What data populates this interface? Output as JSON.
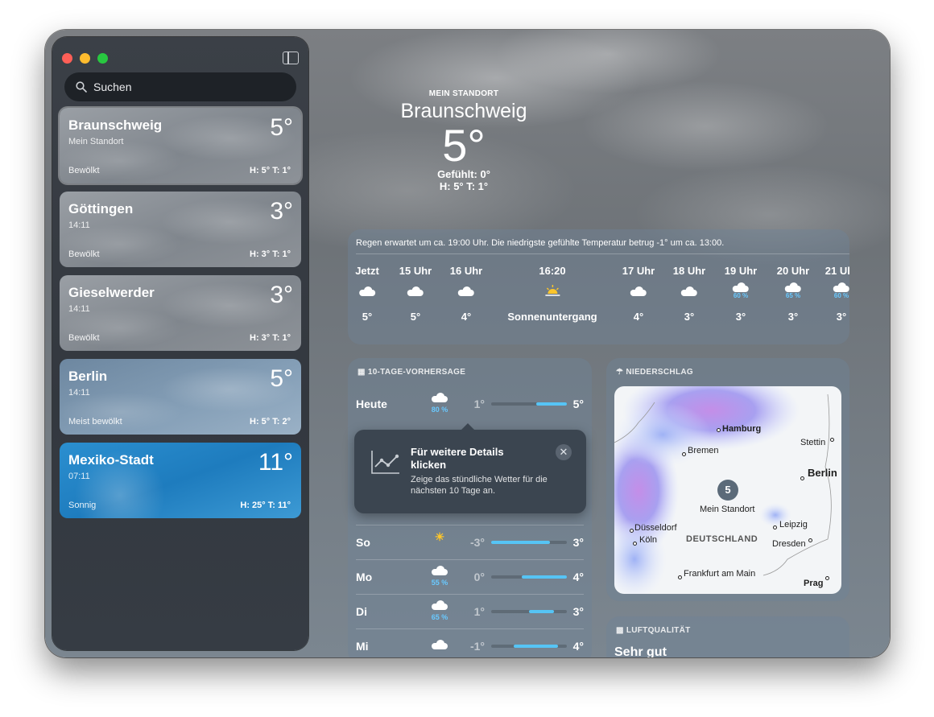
{
  "sidebar": {
    "search_placeholder": "Suchen",
    "locations": [
      {
        "name": "Braunschweig",
        "sub": "Mein Standort",
        "temp": "5°",
        "cond": "Bewölkt",
        "hl": "H: 5°  T: 1°"
      },
      {
        "name": "Göttingen",
        "sub": "14:11",
        "temp": "3°",
        "cond": "Bewölkt",
        "hl": "H: 3°  T: 1°"
      },
      {
        "name": "Gieselwerder",
        "sub": "14:11",
        "temp": "3°",
        "cond": "Bewölkt",
        "hl": "H: 3°  T: 1°"
      },
      {
        "name": "Berlin",
        "sub": "14:11",
        "temp": "5°",
        "cond": "Meist bewölkt",
        "hl": "H: 5°  T: 2°"
      },
      {
        "name": "Mexiko-Stadt",
        "sub": "07:11",
        "temp": "11°",
        "cond": "Sonnig",
        "hl": "H: 25°  T: 11°"
      }
    ]
  },
  "hero": {
    "label": "MEIN STANDORT",
    "city": "Braunschweig",
    "temp": "5°",
    "feels": "Gefühlt: 0°",
    "hilo": "H: 5°  T: 1°"
  },
  "hourly": {
    "message": "Regen erwartet um ca. 19:00 Uhr. Die niedrigste gefühlte Temperatur betrug -1° um ca. 13:00.",
    "items": [
      {
        "time": "Jetzt",
        "icon": "cloud-icon",
        "pct": "",
        "temp": "5°"
      },
      {
        "time": "15 Uhr",
        "icon": "cloud-icon",
        "pct": "",
        "temp": "5°"
      },
      {
        "time": "16 Uhr",
        "icon": "cloud-icon",
        "pct": "",
        "temp": "4°"
      },
      {
        "time": "16:20",
        "icon": "sunset-icon",
        "pct": "",
        "temp": "Sonnenuntergang"
      },
      {
        "time": "17 Uhr",
        "icon": "cloud-icon",
        "pct": "",
        "temp": "4°"
      },
      {
        "time": "18 Uhr",
        "icon": "cloud-icon",
        "pct": "",
        "temp": "3°"
      },
      {
        "time": "19 Uhr",
        "icon": "moon-rain-icon",
        "pct": "60 %",
        "temp": "3°"
      },
      {
        "time": "20 Uhr",
        "icon": "rain-icon",
        "pct": "65 %",
        "temp": "3°"
      },
      {
        "time": "21 Uhr",
        "icon": "moon-rain-icon",
        "pct": "60 %",
        "temp": "3°"
      }
    ]
  },
  "forecast": {
    "title": "10-TAGE-VORHERSAGE",
    "rows": [
      {
        "day": "Heute",
        "icon": "rain-icon",
        "pct": "80 %",
        "lo": "1°",
        "hi": "5°",
        "bar": [
          0.6,
          1.0
        ]
      },
      {
        "day": "So",
        "icon": "partly-sunny-icon",
        "pct": "",
        "lo": "-3°",
        "hi": "3°",
        "bar": [
          0.0,
          0.78
        ]
      },
      {
        "day": "Mo",
        "icon": "rain-icon",
        "pct": "55 %",
        "lo": "0°",
        "hi": "4°",
        "bar": [
          0.4,
          1.0
        ]
      },
      {
        "day": "Di",
        "icon": "rain-icon",
        "pct": "65 %",
        "lo": "1°",
        "hi": "3°",
        "bar": [
          0.5,
          0.83
        ]
      },
      {
        "day": "Mi",
        "icon": "cloud-icon",
        "pct": "",
        "lo": "-1°",
        "hi": "4°",
        "bar": [
          0.3,
          0.88
        ]
      }
    ]
  },
  "tooltip": {
    "title": "Für weitere Details klicken",
    "text": "Zeige das stündliche Wetter für die nächsten 10 Tage an."
  },
  "precip": {
    "title": "NIEDERSCHLAG",
    "badge": "5",
    "my_location": "Mein Standort",
    "country": "DEUTSCHLAND",
    "cities": [
      "Hamburg",
      "Bremen",
      "Stettin",
      "Berlin",
      "Leipzig",
      "Düsseldorf",
      "Köln",
      "Dresden",
      "Frankfurt am Main",
      "Prag"
    ]
  },
  "air": {
    "title": "LUFTQUALITÄT",
    "value": "Sehr gut"
  }
}
